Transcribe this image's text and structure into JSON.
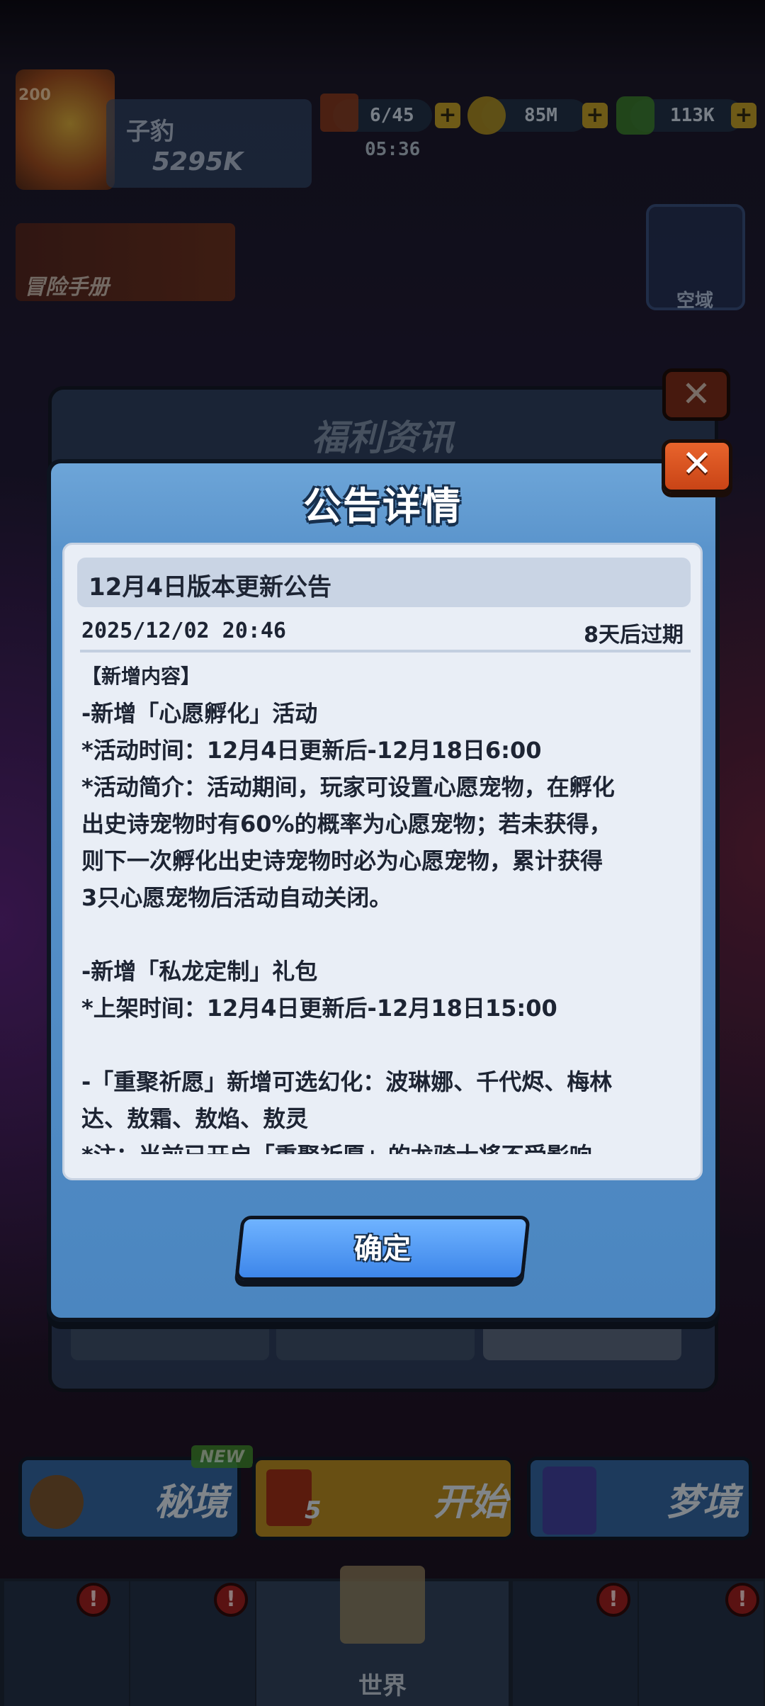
{
  "hud": {
    "avatar_level": "200",
    "player_name": "子豹",
    "player_power": "5295K",
    "energy": "6/45",
    "energy_timer": "05:36",
    "coins": "85M",
    "gems": "113K"
  },
  "background": {
    "handbook_label": "冒险手册",
    "airspace_label": "空域",
    "panel_title": "福利资讯",
    "close_glyph": "✕"
  },
  "modal": {
    "title": "公告详情",
    "close_glyph": "✕",
    "notice": {
      "title": "12月4日版本更新公告",
      "date": "2025/12/02 20:46",
      "expiry": "8天后过期",
      "lines": [
        "【新增内容】",
        "-新增「心愿孵化」活动",
        "*活动时间：12月4日更新后-12月18日6:00",
        "*活动简介：活动期间，玩家可设置心愿宠物，在孵化",
        "出史诗宠物时有60%的概率为心愿宠物；若未获得，",
        "则下一次孵化出史诗宠物时必为心愿宠物，累计获得",
        "3只心愿宠物后活动自动关闭。",
        "",
        "-新增「私龙定制」礼包",
        "*上架时间：12月4日更新后-12月18日15:00",
        "",
        "-「重聚祈愿」新增可选幻化：波琳娜、千代烬、梅林",
        "达、敖霜、敖焰、敖灵",
        "*注：当前已开启「重聚祈愿」的龙骑士将不受影响"
      ]
    },
    "confirm_label": "确定"
  },
  "bottom": {
    "new_badge": "NEW",
    "secret_realm": "秘境",
    "start": "开始",
    "start_cost": "5",
    "dream_realm": "梦境",
    "nav_world": "世界",
    "alert_glyph": "!"
  }
}
